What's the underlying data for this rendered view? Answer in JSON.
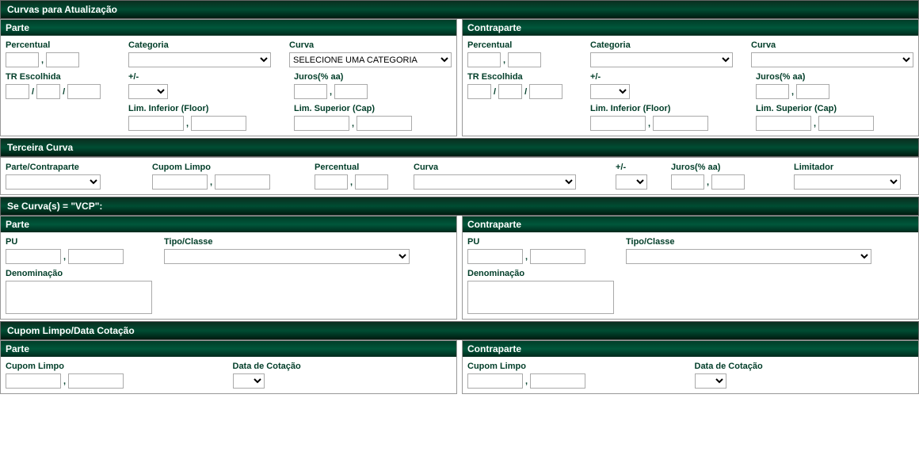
{
  "headers": {
    "curvas": "Curvas para Atualização",
    "terceira": "Terceira Curva",
    "vcp": "Se Curva(s) = \"VCP\":",
    "cupom": "Cupom Limpo/Data Cotação"
  },
  "titles": {
    "parte": "Parte",
    "contraparte": "Contraparte"
  },
  "labels": {
    "percentual": "Percentual",
    "categoria": "Categoria",
    "curva": "Curva",
    "trEscolhida": "TR Escolhida",
    "maisMenos": "+/-",
    "juros": "Juros(% aa)",
    "limInf": "Lim. Inferior (Floor)",
    "limSup": "Lim. Superior (Cap)",
    "parteContraparte": "Parte/Contraparte",
    "cupomLimpo": "Cupom Limpo",
    "limitador": "Limitador",
    "pu": "PU",
    "tipoClasse": "Tipo/Classe",
    "denominacao": "Denominação",
    "dataCotacao": "Data de Cotação"
  },
  "selects": {
    "curvaPlaceholder": "SELECIONE UMA CATEGORIA"
  },
  "sep": {
    "comma": ",",
    "slash": "/"
  }
}
